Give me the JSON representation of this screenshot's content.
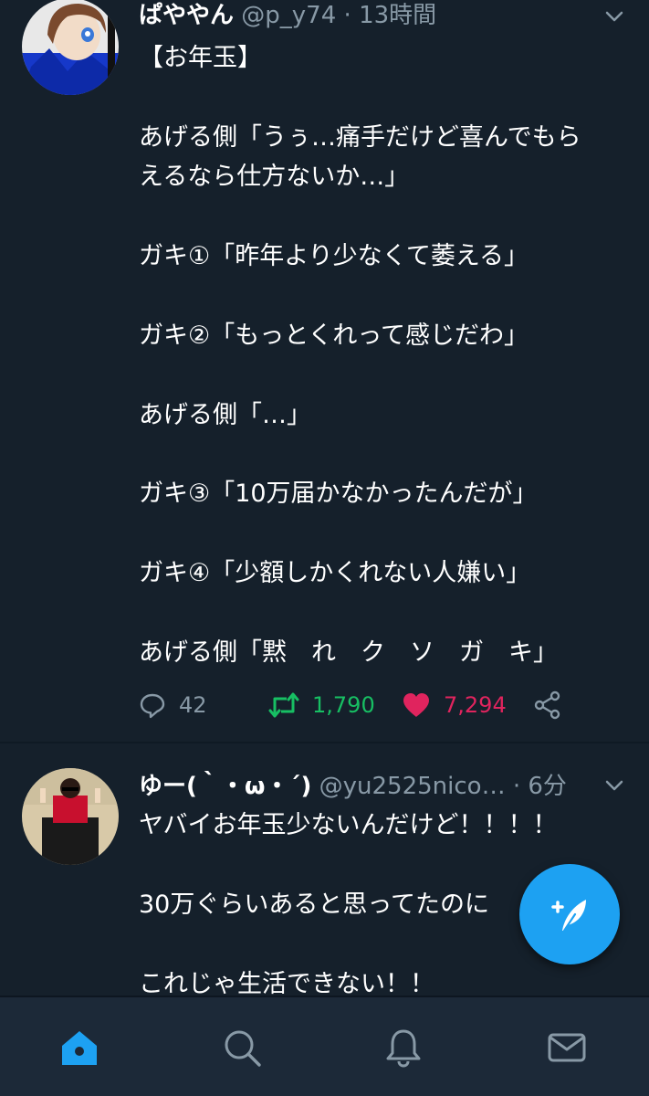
{
  "tweets": [
    {
      "display_name": "ぱややん",
      "handle": "@p_y74",
      "separator": "·",
      "time": "13時間",
      "body_lines": [
        "【お年玉】",
        "",
        "あげる側「うぅ…痛手だけど喜んでもら",
        "えるなら仕方ないか…」",
        "",
        "ガキ①「昨年より少なくて萎える」",
        "",
        "ガキ②「もっとくれって感じだわ」",
        "",
        "あげる側「…」",
        "",
        "ガキ③「10万届かなかったんだが」",
        "",
        "ガキ④「少額しかくれない人嫌い」",
        "",
        "あげる側「黙　れ　ク　ソ　ガ　キ」"
      ],
      "stats": {
        "replies": "42",
        "retweets": "1,790",
        "likes": "7,294"
      }
    },
    {
      "display_name": "ゆー(｀・ω・´)",
      "handle": "@yu2525nico…",
      "separator": "·",
      "time": "6分",
      "body_lines": [
        "ヤバイお年玉少ないんだけど！！！！",
        "",
        "30万ぐらいあると思ってたのに",
        "",
        "これじゃ生活できない！！"
      ]
    }
  ],
  "colors": {
    "background": "#15202b",
    "tabbar": "#1c2938",
    "accent": "#1da1f2",
    "secondary_text": "#8899a6",
    "retweet_active": "#17bf63",
    "like_active": "#e0245e"
  },
  "icons": {
    "reply": "reply-icon",
    "retweet": "retweet-icon",
    "like": "heart-icon",
    "share": "share-icon",
    "compose": "compose-icon",
    "caret": "chevron-down-icon",
    "tabs": [
      "home-icon",
      "search-icon",
      "bell-icon",
      "mail-icon"
    ]
  }
}
